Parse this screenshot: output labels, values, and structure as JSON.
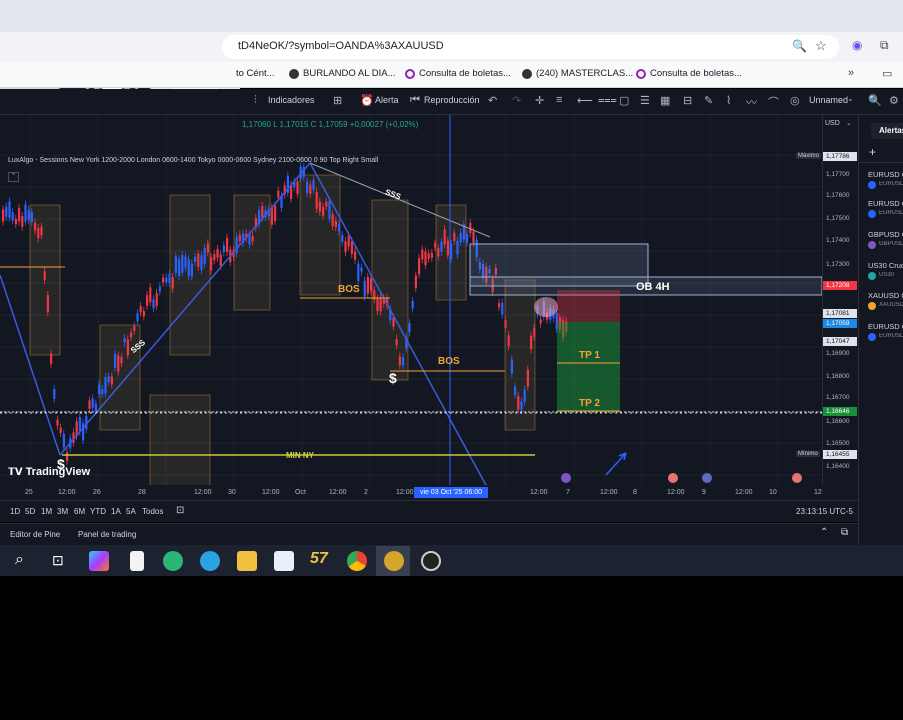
{
  "browser": {
    "url": "tD4NeOK/?symbol=OANDA%3AXAUUSD",
    "bookmarks": [
      "to Cént...",
      "BURLANDO AL DIA...",
      "Consulta de boletas...",
      "(240) MASTERCLAS...",
      "Consulta de boletas..."
    ]
  },
  "toolbar": {
    "indicators_label": "Indicadores",
    "alert_label": "Alerta",
    "replay_label": "Reproducción",
    "layout_label": "Unnamed"
  },
  "chart": {
    "ohlc_text": "1,17060  L 1,17015  C 1,17059  +0,00027 (+0,02%)",
    "indicator_text": "LuxAlgo - Sessions New York 1200-2000 London 0600-1400 Tokyo 0000-0600 Sydney 2100-0600 0 90 Top Right Small",
    "currency": "USD",
    "price_labels": [
      "1,17786",
      "1,17700",
      "1,17600",
      "1,17500",
      "1,17400",
      "1,17300",
      "1,17208",
      "1,17081",
      "1,17059",
      "1,17047",
      "1,16900",
      "1,16800",
      "1,16700",
      "1,16646",
      "1,16600",
      "1,16500",
      "1,16455",
      "1,16400"
    ],
    "max_label": "Máximo",
    "min_label": "Mínimo",
    "time_labels": [
      "25",
      "12:00",
      "26",
      "28",
      "12:00",
      "30",
      "12:00",
      "Oct",
      "12:00",
      "2",
      "12:00",
      "12:00",
      "7",
      "12:00",
      "8",
      "12:00",
      "9",
      "12:00",
      "10",
      "12"
    ],
    "crosshair_time": "vie 03 Oct '25  06:00",
    "annotations": {
      "bos1": "BOS",
      "bos2": "BOS",
      "ob": "OB 4H",
      "tp1": "TP 1",
      "tp2": "TP 2",
      "min_ny": "MIN NY",
      "dollar1": "$",
      "dollar2": "$",
      "sss1": "SSS",
      "sss2": "SSS"
    },
    "logo": "TradingView",
    "sessions": [
      "London",
      "New York"
    ]
  },
  "ranges": [
    "1D",
    "5D",
    "1M",
    "3M",
    "6M",
    "YTD",
    "1A",
    "5A",
    "Todos"
  ],
  "clock": "23:13:15 UTC-5",
  "panels": [
    "Editor de Pine",
    "Panel de trading"
  ],
  "watchlist": {
    "header": "Alertas",
    "items": [
      {
        "symbol": "EURUSD C",
        "sub": "EURUSD"
      },
      {
        "symbol": "EURUSD C",
        "sub": "EURUSD"
      },
      {
        "symbol": "GBPUSD C",
        "sub": "GBPUSD"
      },
      {
        "symbol": "US30 Cruc",
        "sub": "US30"
      },
      {
        "symbol": "XAUUSD C",
        "sub": "XAUUSD"
      },
      {
        "symbol": "EURUSD C",
        "sub": "EURUSD"
      }
    ]
  },
  "colors": {
    "bg": "#131722",
    "bull": "#2962ff",
    "bear": "#f23645",
    "orange": "#f7a234",
    "yellow": "#c9c93a",
    "green": "#1b8f3a"
  }
}
